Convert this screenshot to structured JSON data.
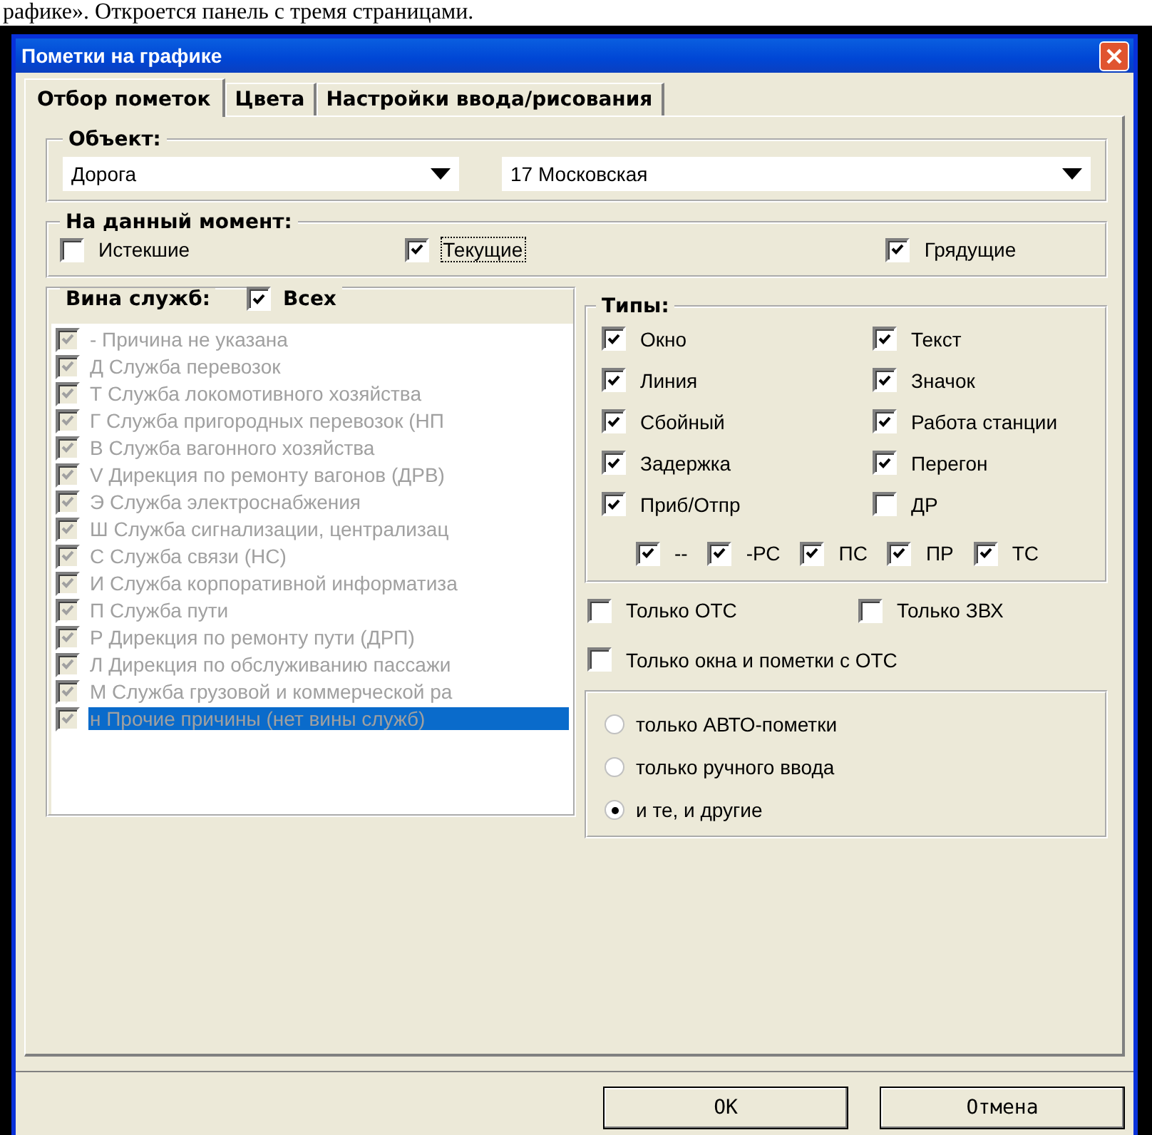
{
  "document_caption": "рафике». Откроется панель с тремя страницами.",
  "window": {
    "title": "Пометки на графике"
  },
  "tabs": [
    {
      "label": "Отбор пометок",
      "selected": true
    },
    {
      "label": "Цвета",
      "selected": false
    },
    {
      "label": "Настройки ввода/рисования",
      "selected": false
    }
  ],
  "object": {
    "title": "Объект:",
    "combos": [
      {
        "value": "Дорога"
      },
      {
        "value": "17 Московская"
      }
    ]
  },
  "moment": {
    "title": "На данный момент:",
    "items": [
      {
        "label": "Истекшие",
        "checked": false,
        "focused": false
      },
      {
        "label": "Текущие",
        "checked": true,
        "focused": true
      },
      {
        "label": "Грядущие",
        "checked": true,
        "focused": false
      }
    ]
  },
  "fault": {
    "title": "Вина служб:",
    "all_label": "Всех",
    "all_checked": true,
    "disabled": true,
    "items": [
      {
        "label": "- Причина не указана",
        "checked": true,
        "selected": false
      },
      {
        "label": "Д Служба перевозок",
        "checked": true,
        "selected": false
      },
      {
        "label": "Т Служба локомотивного хозяйства",
        "checked": true,
        "selected": false
      },
      {
        "label": "Г Служба пригородных перевозок (НП",
        "checked": true,
        "selected": false
      },
      {
        "label": "В Служба вагонного хозяйства",
        "checked": true,
        "selected": false
      },
      {
        "label": "V Дирекция по ремонту вагонов (ДРВ)",
        "checked": true,
        "selected": false
      },
      {
        "label": "Э Служба электроснабжения",
        "checked": true,
        "selected": false
      },
      {
        "label": "Ш Служба сигнализации, централизац",
        "checked": true,
        "selected": false
      },
      {
        "label": "С Служба связи (НС)",
        "checked": true,
        "selected": false
      },
      {
        "label": "И Служба корпоративной информатиза",
        "checked": true,
        "selected": false
      },
      {
        "label": "П Служба пути",
        "checked": true,
        "selected": false
      },
      {
        "label": "Р Дирекция по ремонту пути (ДРП)",
        "checked": true,
        "selected": false
      },
      {
        "label": "Л Дирекция по обслуживанию пассажи",
        "checked": true,
        "selected": false
      },
      {
        "label": "М Служба грузовой и коммерческой ра",
        "checked": true,
        "selected": false
      },
      {
        "label": "н Прочие причины (нет вины служб)",
        "checked": true,
        "selected": true
      }
    ]
  },
  "types": {
    "title": "Типы:",
    "items": [
      {
        "label": "Окно",
        "checked": true
      },
      {
        "label": "Текст",
        "checked": true
      },
      {
        "label": "Линия",
        "checked": true
      },
      {
        "label": "Значок",
        "checked": true
      },
      {
        "label": "Сбойный",
        "checked": true
      },
      {
        "label": "Работа станции",
        "checked": true
      },
      {
        "label": "Задержка",
        "checked": true
      },
      {
        "label": "Перегон",
        "checked": true
      },
      {
        "label": "Приб/Отпр",
        "checked": true
      },
      {
        "label": "ДР",
        "checked": false
      }
    ],
    "sub_items": [
      {
        "label": "--",
        "checked": true
      },
      {
        "label": "-РС",
        "checked": true
      },
      {
        "label": "ПС",
        "checked": true
      },
      {
        "label": "ПР",
        "checked": true
      },
      {
        "label": "ТС",
        "checked": true
      }
    ]
  },
  "filters": [
    {
      "label": "Только ОТС",
      "checked": false
    },
    {
      "label": "Только ЗВХ",
      "checked": false
    },
    {
      "label": "Только окна и пометки с ОТС",
      "checked": false
    }
  ],
  "source": [
    {
      "label": "только АВТО-пометки",
      "selected": false
    },
    {
      "label": "только ручного ввода",
      "selected": false
    },
    {
      "label": "и те, и другие",
      "selected": true
    }
  ],
  "buttons": [
    {
      "label": "OK"
    },
    {
      "label": "Отмена"
    }
  ]
}
